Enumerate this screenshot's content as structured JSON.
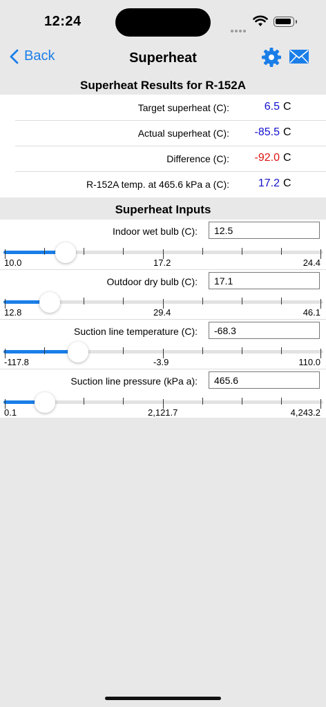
{
  "status_bar": {
    "time": "12:24"
  },
  "nav": {
    "back_label": "Back",
    "title": "Superheat",
    "settings_icon": "gear-icon",
    "mail_icon": "envelope-icon"
  },
  "colors": {
    "accent": "#1a7ee8",
    "positive_value": "#1111cc",
    "negative_value": "#dd1111"
  },
  "results": {
    "header": "Superheat Results for R-152A",
    "rows": [
      {
        "label": "Target superheat (C):",
        "value": "6.5",
        "unit": "C",
        "value_color": "#1111cc"
      },
      {
        "label": "Actual superheat (C):",
        "value": "-85.5",
        "unit": "C",
        "value_color": "#1111cc"
      },
      {
        "label": "Difference (C):",
        "value": "-92.0",
        "unit": "C",
        "value_color": "#dd1111"
      },
      {
        "label": "R-152A temp. at 465.6 kPa a (C):",
        "value": "17.2",
        "unit": "C",
        "value_color": "#1111cc"
      }
    ]
  },
  "inputs": {
    "header": "Superheat Inputs",
    "items": [
      {
        "label": "Indoor wet bulb (C):",
        "value": "12.5",
        "min_label": "10.0",
        "mid_label": "17.2",
        "max_label": "24.4",
        "slider_fraction": 0.194
      },
      {
        "label": "Outdoor dry bulb (C):",
        "value": "17.1",
        "min_label": "12.8",
        "mid_label": "29.4",
        "max_label": "46.1",
        "slider_fraction": 0.145
      },
      {
        "label": "Suction line temperature (C):",
        "value": "-68.3",
        "min_label": "-117.8",
        "mid_label": "-3.9",
        "max_label": "110.0",
        "slider_fraction": 0.233
      },
      {
        "label": "Suction line pressure (kPa a):",
        "value": "465.6",
        "min_label": "0.1",
        "mid_label": "2,121.7",
        "max_label": "4,243.2",
        "slider_fraction": 0.13
      }
    ]
  }
}
